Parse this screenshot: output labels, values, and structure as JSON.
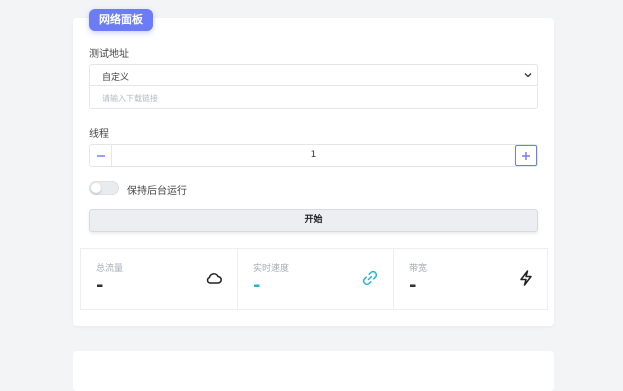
{
  "panel": {
    "badge": "网络面板",
    "test_address_label": "测试地址",
    "address_select": {
      "value": "自定义"
    },
    "download_input": {
      "placeholder": "请输入下载链接"
    },
    "threads_label": "线程",
    "threads_value": "1",
    "background_toggle": {
      "label": "保持后台运行",
      "on": false
    },
    "start_button": "开始"
  },
  "stats": [
    {
      "title": "总流量",
      "value": "-",
      "icon": "cloud-icon"
    },
    {
      "title": "实时速度",
      "value": "-",
      "icon": "link-icon",
      "color": "#22b8cf"
    },
    {
      "title": "带宽",
      "value": "-",
      "icon": "lightning-icon"
    }
  ],
  "colors": {
    "accent": "#6c7cf6",
    "speed": "#22b8cf"
  }
}
